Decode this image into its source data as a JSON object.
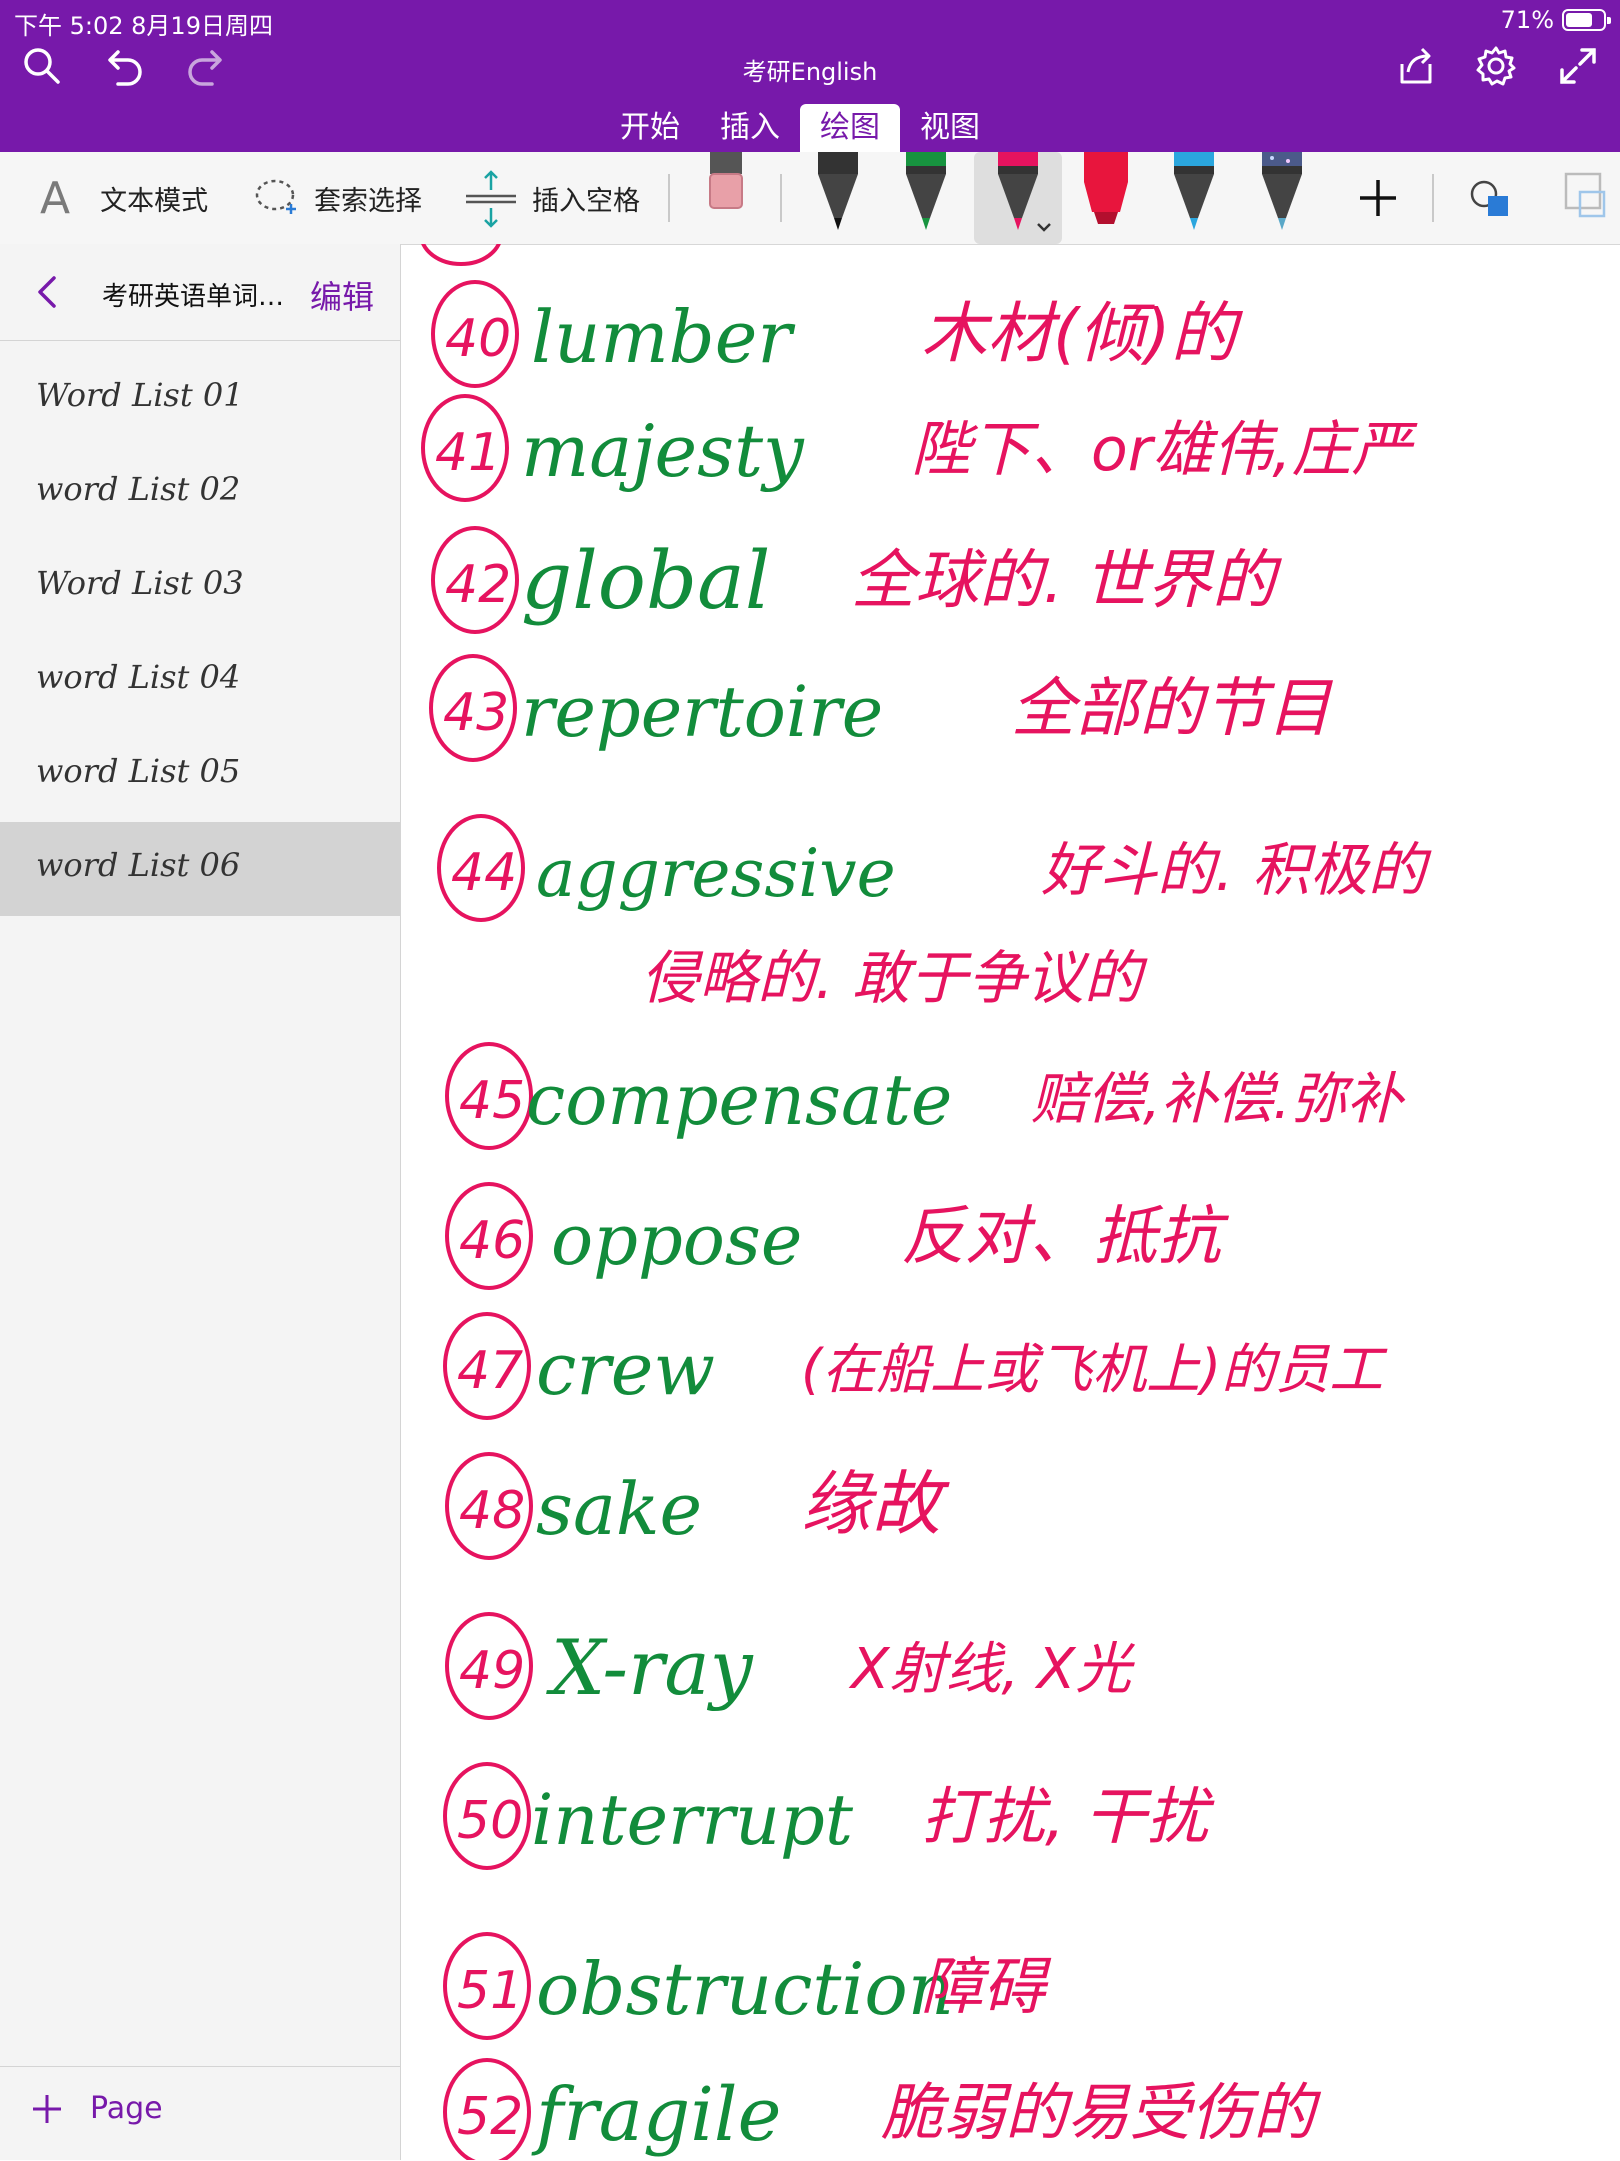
{
  "status_bar": {
    "time": "下午 5:02   8月19日周四",
    "battery": "71%"
  },
  "app": {
    "title": "考研English"
  },
  "ribbon": {
    "tabs": [
      "开始",
      "插入",
      "绘图",
      "视图"
    ],
    "active_tab": "绘图"
  },
  "toolbar": {
    "text_mode": "文本模式",
    "lasso_select": "套索选择",
    "insert_space": "插入空格",
    "pens": [
      {
        "name": "eraser",
        "color": "#e8a0a8"
      },
      {
        "name": "black-pen",
        "color": "#222222"
      },
      {
        "name": "green-pen",
        "color": "#17933f"
      },
      {
        "name": "pink-pen",
        "color": "#e6135f"
      },
      {
        "name": "red-highlighter",
        "color": "#e8153d"
      },
      {
        "name": "blue-pen",
        "color": "#2ba6de"
      },
      {
        "name": "galaxy-pen",
        "color": "#4b5a8a"
      }
    ]
  },
  "sidebar": {
    "notebook": "考研英语单词…",
    "edit": "编辑",
    "pages": [
      "Word List 01",
      "word List 02",
      "Word List 03",
      "word List 04",
      "word List 05",
      "word List 06"
    ],
    "selected_page": "word List 06",
    "add_page": "Page"
  },
  "notes": [
    {
      "num": "40",
      "word": "lumber",
      "meaning": "木材(倾)的"
    },
    {
      "num": "41",
      "word": "majesty",
      "meaning": "陛下、or雄伟,庄严"
    },
    {
      "num": "42",
      "word": "global",
      "meaning": "全球的. 世界的"
    },
    {
      "num": "43",
      "word": "repertoire",
      "meaning": "全部的节目"
    },
    {
      "num": "44",
      "word": "aggressive",
      "meaning": "好斗的. 积极的"
    },
    {
      "num": "",
      "word": "",
      "meaning": "侵略的. 敢于争议的"
    },
    {
      "num": "45",
      "word": "compensate",
      "meaning": "赔偿,补偿.弥补"
    },
    {
      "num": "46",
      "word": "oppose",
      "meaning": "反对、抵抗"
    },
    {
      "num": "47",
      "word": "crew",
      "meaning": "(在船上或飞机上)的员工"
    },
    {
      "num": "48",
      "word": "sake",
      "meaning": "缘故"
    },
    {
      "num": "49",
      "word": "X-ray",
      "meaning": "X射线, X光"
    },
    {
      "num": "50",
      "word": "interrupt",
      "meaning": "打扰, 干扰"
    },
    {
      "num": "51",
      "word": "obstruction",
      "meaning": "障碍"
    },
    {
      "num": "52",
      "word": "fragile",
      "meaning": "脆弱的易受伤的"
    }
  ]
}
